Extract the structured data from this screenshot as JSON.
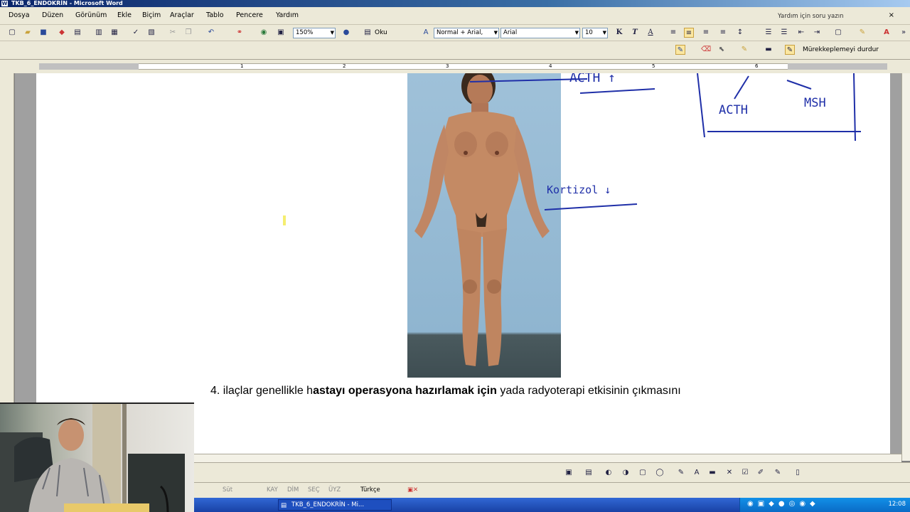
{
  "window": {
    "title": "TKB_6_ENDOKRİN - Microsoft Word"
  },
  "menu": {
    "items": [
      "Dosya",
      "Düzen",
      "Görünüm",
      "Ekle",
      "Biçim",
      "Araçlar",
      "Tablo",
      "Pencere",
      "Yardım"
    ],
    "help_placeholder": "Yardım için soru yazın",
    "close_glyph": "×"
  },
  "toolbar": {
    "zoom": "150%",
    "read_label": "Oku",
    "style": "Normal + Arial,",
    "font": "Arial",
    "size": "10",
    "bold": "K",
    "italic": "T",
    "underline": "A"
  },
  "ink_toolbar": {
    "stop_inking": "Mürekkeplemeyi durdur"
  },
  "ruler": {
    "numbers": [
      "1",
      "2",
      "3",
      "4",
      "5",
      "6"
    ]
  },
  "document": {
    "caption_prefix": "4. ilaçlar genellikle h",
    "caption_bold": "astayı operasyona hazırlamak için",
    "caption_suffix": " yada radyoterapi etkisinin çıkmasını",
    "annotations": {
      "acth_top": "ACTH ↑",
      "acth_box": "ACTH",
      "msh_box": "MSH",
      "kortizol": "Kortizol ↓"
    }
  },
  "statusbar": {
    "items": [
      "Süt",
      "KAY",
      "DİM",
      "SEÇ",
      "ÜYZ",
      "Türkçe"
    ]
  },
  "taskbar": {
    "button": "TKB_6_ENDOKRİN - Mi...",
    "clock": "12:08"
  },
  "colors": {
    "ink": "#1f2fa8",
    "menu_bg": "#ece9d8",
    "title_blue": "#0a246a"
  }
}
